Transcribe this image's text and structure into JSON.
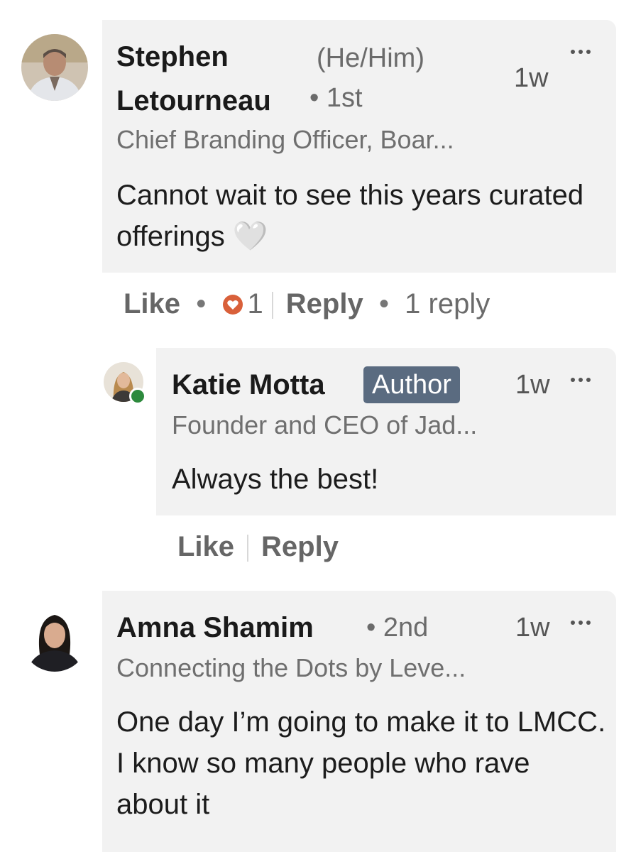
{
  "comments": [
    {
      "name_line1": "Stephen",
      "name_line2": "Letourneau",
      "pronouns": "(He/Him)",
      "degree": "• 1st",
      "time": "1w",
      "headline": "Chief Branding Officer, Boar...",
      "text": "Cannot wait to see this years curated offerings 🤍",
      "actions": {
        "like": "Like",
        "reaction_count": "1",
        "reply": "Reply",
        "replies": "1 reply"
      }
    },
    {
      "name": "Katie Motta",
      "badge": "Author",
      "time": "1w",
      "headline": "Founder and CEO of Jad...",
      "text": "Always the best!",
      "actions": {
        "like": "Like",
        "reply": "Reply"
      }
    },
    {
      "name": "Amna Shamim",
      "degree": "• 2nd",
      "time": "1w",
      "headline": "Connecting the Dots by Leve...",
      "text": "One day I’m going to make it to LMCC. I know so many people who rave about it"
    }
  ],
  "colors": {
    "bubble": "#f2f2f2",
    "author_badge": "#5a6b80",
    "reaction_heart": "#d9603a",
    "online": "#2d8a3d"
  },
  "icons": {
    "reaction": "heart-reaction-icon",
    "more": "more-options-icon"
  }
}
